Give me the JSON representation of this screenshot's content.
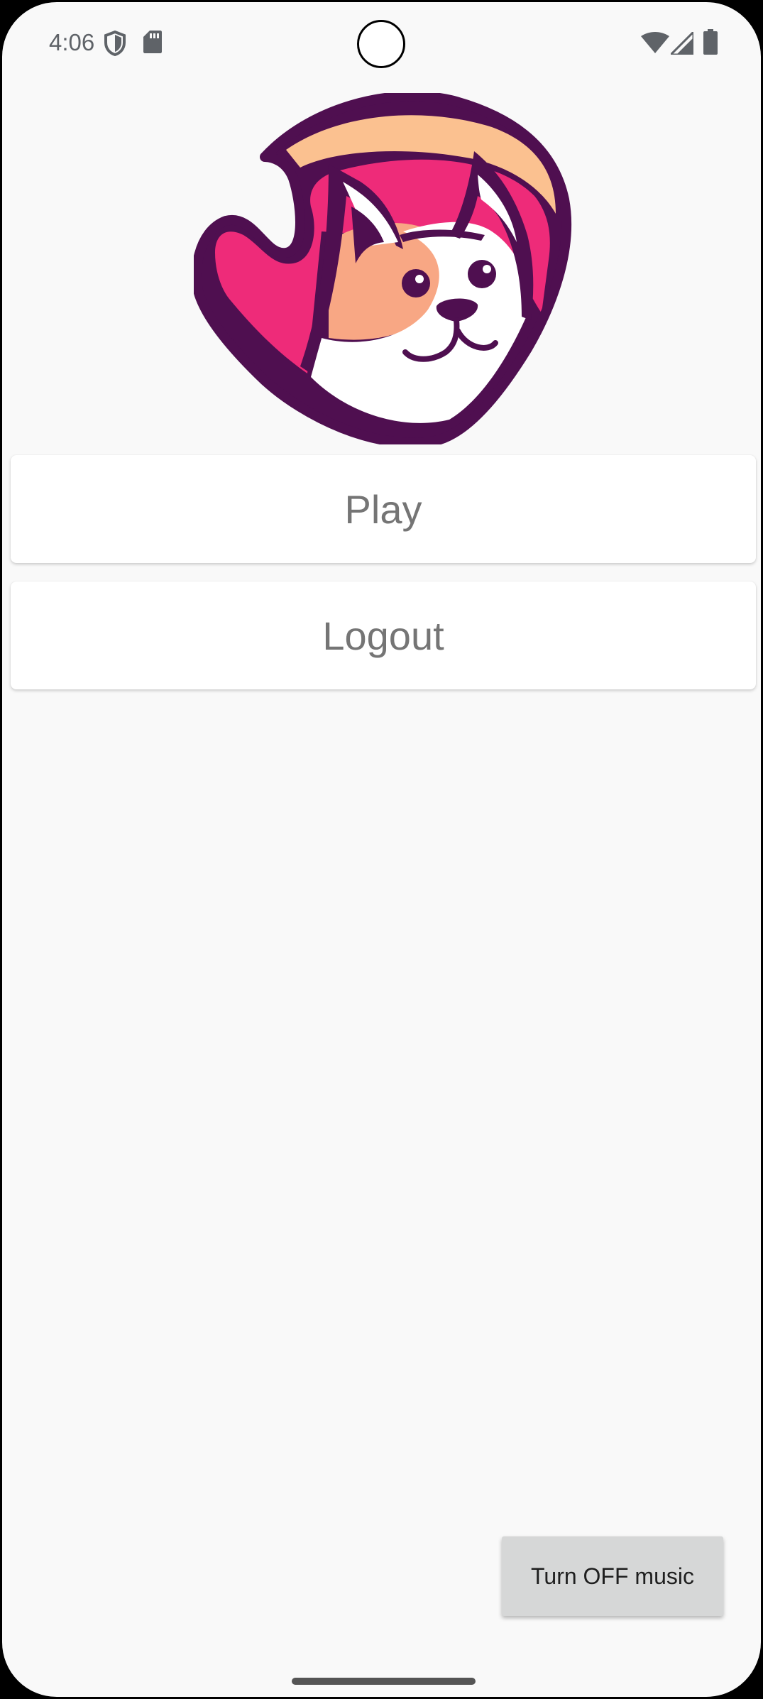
{
  "status_bar": {
    "time": "4:06",
    "icons": [
      "shield-icon",
      "sd-card-icon",
      "wifi-icon",
      "signal-icon",
      "battery-icon"
    ]
  },
  "logo": {
    "description_icon": "cat-mascot-logo",
    "colors": {
      "outline": "#4f0f50",
      "pink": "#ee2b79",
      "peach": "#f8a784",
      "cream": "#fbc190",
      "white": "#ffffff"
    }
  },
  "menu": {
    "play_label": "Play",
    "logout_label": "Logout"
  },
  "music_toggle": {
    "label": "Turn OFF music"
  },
  "colors": {
    "background": "#f9f9f9",
    "button_bg": "#ffffff",
    "button_text": "#757575",
    "music_button_bg": "#d6d7d7"
  }
}
